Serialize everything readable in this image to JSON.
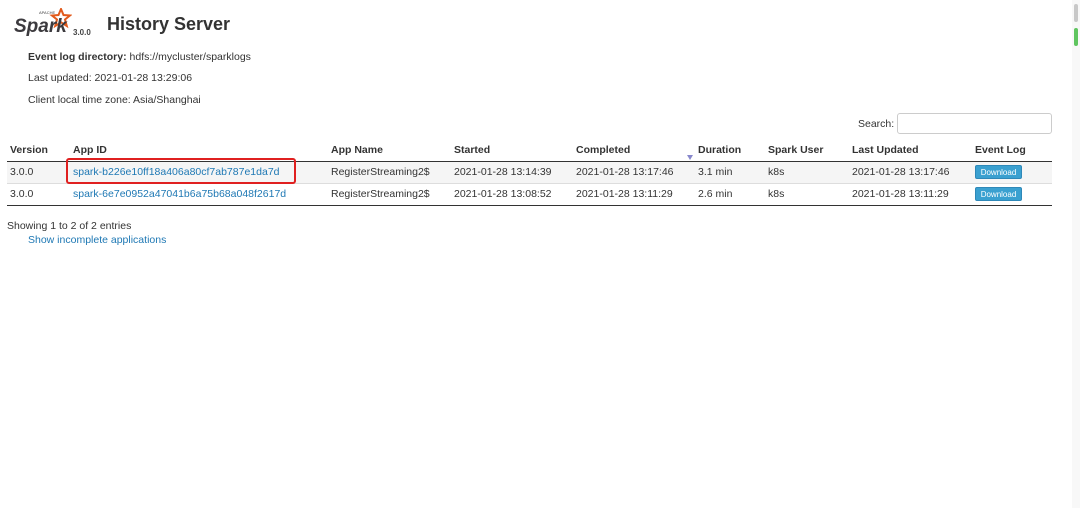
{
  "header": {
    "logo_text": "Spark",
    "logo_small": "APACHE",
    "version": "3.0.0",
    "title": "History Server"
  },
  "info": {
    "event_log_label": "Event log directory:",
    "event_log_value": "hdfs://mycluster/sparklogs",
    "last_updated": "Last updated: 2021-01-28 13:29:06",
    "timezone": "Client local time zone: Asia/Shanghai"
  },
  "search": {
    "label": "Search:",
    "value": ""
  },
  "table": {
    "headers": [
      "Version",
      "App ID",
      "App Name",
      "Started",
      "Completed",
      "Duration",
      "Spark User",
      "Last Updated",
      "Event Log"
    ],
    "rows": [
      {
        "version": "3.0.0",
        "app_id": "spark-b226e10ff18a406a80cf7ab787e1da7d",
        "app_name": "RegisterStreaming2$",
        "started": "2021-01-28 13:14:39",
        "completed": "2021-01-28 13:17:46",
        "duration": "3.1 min",
        "user": "k8s",
        "last_updated": "2021-01-28 13:17:46",
        "event_log": "Download"
      },
      {
        "version": "3.0.0",
        "app_id": "spark-6e7e0952a47041b6a75b68a048f2617d",
        "app_name": "RegisterStreaming2$",
        "started": "2021-01-28 13:08:52",
        "completed": "2021-01-28 13:11:29",
        "duration": "2.6 min",
        "user": "k8s",
        "last_updated": "2021-01-28 13:11:29",
        "event_log": "Download"
      }
    ]
  },
  "footer": {
    "entries": "Showing 1 to 2 of 2 entries",
    "incomplete_link": "Show incomplete applications"
  },
  "colors": {
    "link": "#1e78b4",
    "download_button": "#3aa0d0",
    "highlight": "#e02020",
    "logo_orange": "#e25a1c"
  }
}
